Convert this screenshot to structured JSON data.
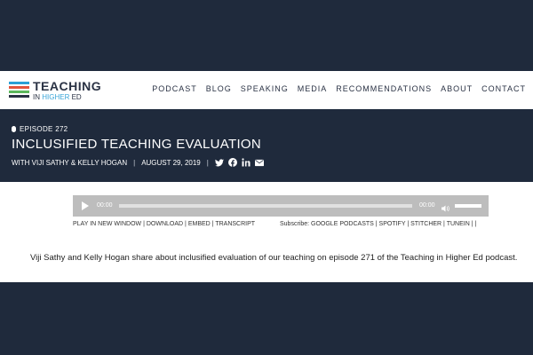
{
  "logo": {
    "main": "TEACHING",
    "sub_prefix": "IN",
    "sub_highlight": "HIGHER",
    "sub_suffix": "ED",
    "stripe_colors": [
      "#2a9fd6",
      "#e2533d",
      "#5cb85c",
      "#2a3244"
    ]
  },
  "nav": [
    "PODCAST",
    "BLOG",
    "SPEAKING",
    "MEDIA",
    "RECOMMENDATIONS",
    "ABOUT",
    "CONTACT"
  ],
  "episode": {
    "label": "EPISODE 272",
    "title": "INCLUSIFIED TEACHING EVALUATION",
    "guests": "WITH VIJI SATHY & KELLY HOGAN",
    "date": "AUGUST 29, 2019",
    "social_icons": [
      "twitter-icon",
      "facebook-icon",
      "linkedin-icon",
      "email-icon"
    ]
  },
  "player": {
    "current_time": "00:00",
    "duration": "00:00",
    "progress": 0
  },
  "player_links": [
    "PLAY IN NEW WINDOW",
    "DOWNLOAD",
    "EMBED",
    "TRANSCRIPT"
  ],
  "subscribe": {
    "label": "Subscribe:",
    "items": [
      "GOOGLE PODCASTS",
      "SPOTIFY",
      "STITCHER",
      "TUNEIN"
    ]
  },
  "description": "Viji Sathy and Kelly Hogan share about inclusified evaluation of our teaching on episode 271 of the Teaching in Higher Ed podcast.",
  "colors": {
    "dark_navy": "#1f2a3c",
    "accent_blue": "#3aa5d8"
  }
}
